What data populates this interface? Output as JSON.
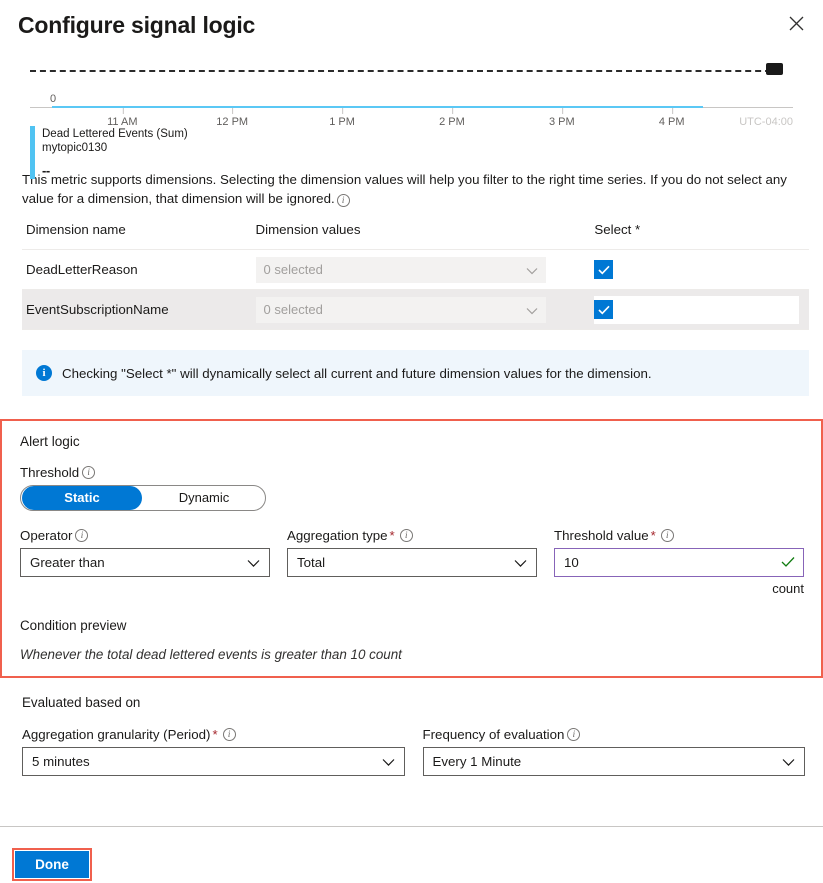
{
  "header": {
    "title": "Configure signal logic",
    "close_label": "Close"
  },
  "chart": {
    "legend_title": "Dead Lettered Events (Sum)",
    "legend_subtitle": "mytopic0130",
    "legend_value": "--",
    "y_zero": "0",
    "timezone": "UTC-04:00"
  },
  "chart_data": {
    "type": "line",
    "title": "Dead Lettered Events (Sum)",
    "subtitle": "mytopic0130",
    "xlabel": "",
    "ylabel": "",
    "x": [
      "11 AM",
      "12 PM",
      "1 PM",
      "2 PM",
      "3 PM",
      "4 PM"
    ],
    "tick_positions_pct": [
      12.1,
      26.5,
      40.9,
      55.3,
      69.7,
      84.1
    ],
    "series": [
      {
        "name": "Dead Lettered Events (Sum)",
        "values": [
          0,
          0,
          0,
          0,
          0,
          0
        ],
        "color": "#50c3f2"
      }
    ],
    "threshold": {
      "value": 10,
      "style": "dashed",
      "color": "#2b2b2b",
      "marker": "end-handle"
    },
    "ylim": [
      0,
      10
    ],
    "yticks": [
      "0"
    ],
    "grid": false,
    "legend_position": "bottom-left",
    "timezone": "UTC-04:00",
    "current_value": "--"
  },
  "dimensions": {
    "description": "This metric supports dimensions. Selecting the dimension values will help you filter to the right time series. If you do not select any value for a dimension, that dimension will be ignored.",
    "columns": {
      "name": "Dimension name",
      "values": "Dimension values",
      "select": "Select *"
    },
    "rows": [
      {
        "name": "DeadLetterReason",
        "value": "0 selected",
        "checked": true
      },
      {
        "name": "EventSubscriptionName",
        "value": "0 selected",
        "checked": true
      }
    ],
    "add_label": "+"
  },
  "banner": {
    "icon": "info-icon",
    "text": "Checking \"Select *\" will dynamically select all current and future dimension values for the dimension."
  },
  "alert_logic": {
    "section_title": "Alert logic",
    "threshold_label": "Threshold",
    "threshold_options": [
      "Static",
      "Dynamic"
    ],
    "threshold_selected": "Static",
    "operator_label": "Operator",
    "operator_value": "Greater than",
    "aggregation_label": "Aggregation type",
    "aggregation_value": "Total",
    "threshold_value_label": "Threshold value",
    "threshold_value": "10",
    "unit": "count",
    "condition_preview_label": "Condition preview",
    "condition_preview_text": "Whenever the total dead lettered events is greater than 10 count"
  },
  "evaluated": {
    "title": "Evaluated based on",
    "granularity_label": "Aggregation granularity (Period)",
    "granularity_value": "5 minutes",
    "frequency_label": "Frequency of evaluation",
    "frequency_value": "Every 1 Minute"
  },
  "footer": {
    "done_label": "Done"
  },
  "colors": {
    "accent": "#0078d4",
    "highlight_border": "#f0604d",
    "validation_ok": "#107c10",
    "input_focus": "#8764b8",
    "required_star": "#a4262c",
    "series": "#50c3f2",
    "banner_bg": "#eff6fc"
  }
}
